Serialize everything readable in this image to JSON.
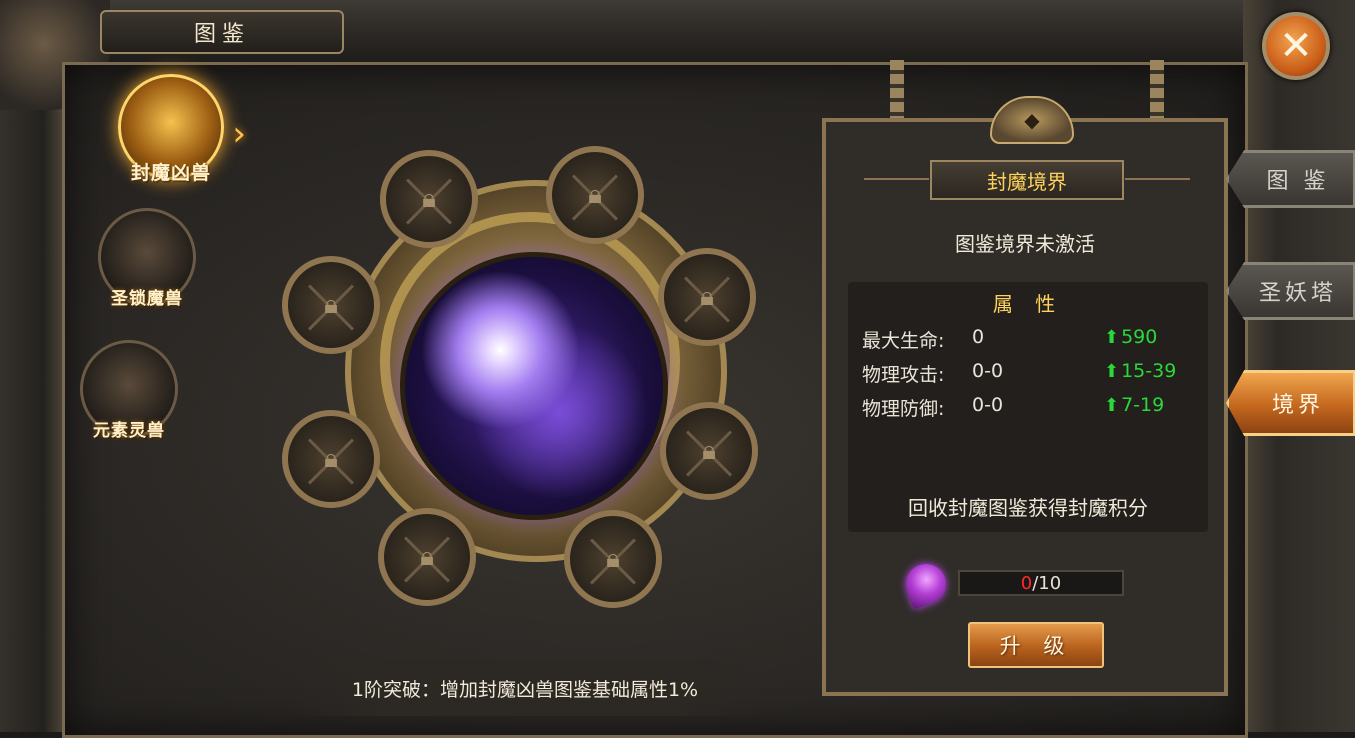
{
  "window": {
    "title": "图鉴"
  },
  "close_button": {
    "icon": "close-icon"
  },
  "categories": [
    {
      "label": "封魔凶兽",
      "active": true
    },
    {
      "label": "圣锁魔兽",
      "active": false
    },
    {
      "label": "元素灵兽",
      "active": false
    }
  ],
  "wheel": {
    "slots": [
      {
        "state": "locked"
      },
      {
        "state": "locked"
      },
      {
        "state": "locked"
      },
      {
        "state": "locked"
      },
      {
        "state": "locked"
      },
      {
        "state": "locked"
      },
      {
        "state": "locked"
      },
      {
        "state": "locked"
      }
    ],
    "breakthrough_text": "1阶突破：增加封魔凶兽图鉴基础属性1%"
  },
  "realm_panel": {
    "title": "封魔境界",
    "status": "图鉴境界未激活",
    "attributes_header": "属 性",
    "attributes": [
      {
        "name": "最大生命:",
        "value": "0",
        "bonus": "590"
      },
      {
        "name": "物理攻击:",
        "value": "0-0",
        "bonus": "15-39"
      },
      {
        "name": "物理防御:",
        "value": "0-0",
        "bonus": "7-19"
      }
    ],
    "recycle_text": "回收封魔图鉴获得封魔积分",
    "progress": {
      "current": "0",
      "total": "/10"
    },
    "upgrade_button": "升 级"
  },
  "side_tabs": [
    {
      "label": "图 鉴",
      "active": false
    },
    {
      "label": "圣妖塔",
      "active": false
    },
    {
      "label": "境界",
      "active": true
    }
  ],
  "colors": {
    "accent_gold": "#ffd35a",
    "bonus_green": "#2bd83a",
    "progress_red": "#ff2a2a",
    "active_tab_orange": "#c4671e"
  }
}
